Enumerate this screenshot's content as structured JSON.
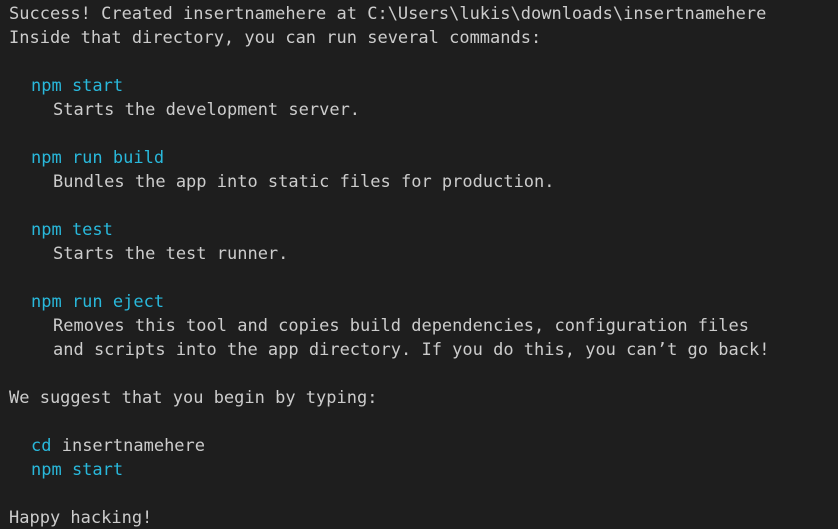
{
  "terminal": {
    "success_line": "Success! Created insertnamehere at C:\\Users\\lukis\\downloads\\insertnamehere",
    "inside_line": "Inside that directory, you can run several commands:",
    "commands": [
      {
        "command": "npm start",
        "description": "Starts the development server."
      },
      {
        "command": "npm run build",
        "description": "Bundles the app into static files for production."
      },
      {
        "command": "npm test",
        "description": "Starts the test runner."
      },
      {
        "command": "npm run eject",
        "description": "Removes this tool and copies build dependencies, configuration files",
        "description_cont": "and scripts into the app directory. If you do this, you can’t go back!"
      }
    ],
    "suggest_line": "We suggest that you begin by typing:",
    "cd_command": "cd",
    "cd_target": " insertnamehere",
    "start_command": "npm start",
    "happy_line": "Happy hacking!"
  },
  "colors": {
    "background": "#1e1e1e",
    "text": "#cccccc",
    "command": "#29b8db"
  }
}
